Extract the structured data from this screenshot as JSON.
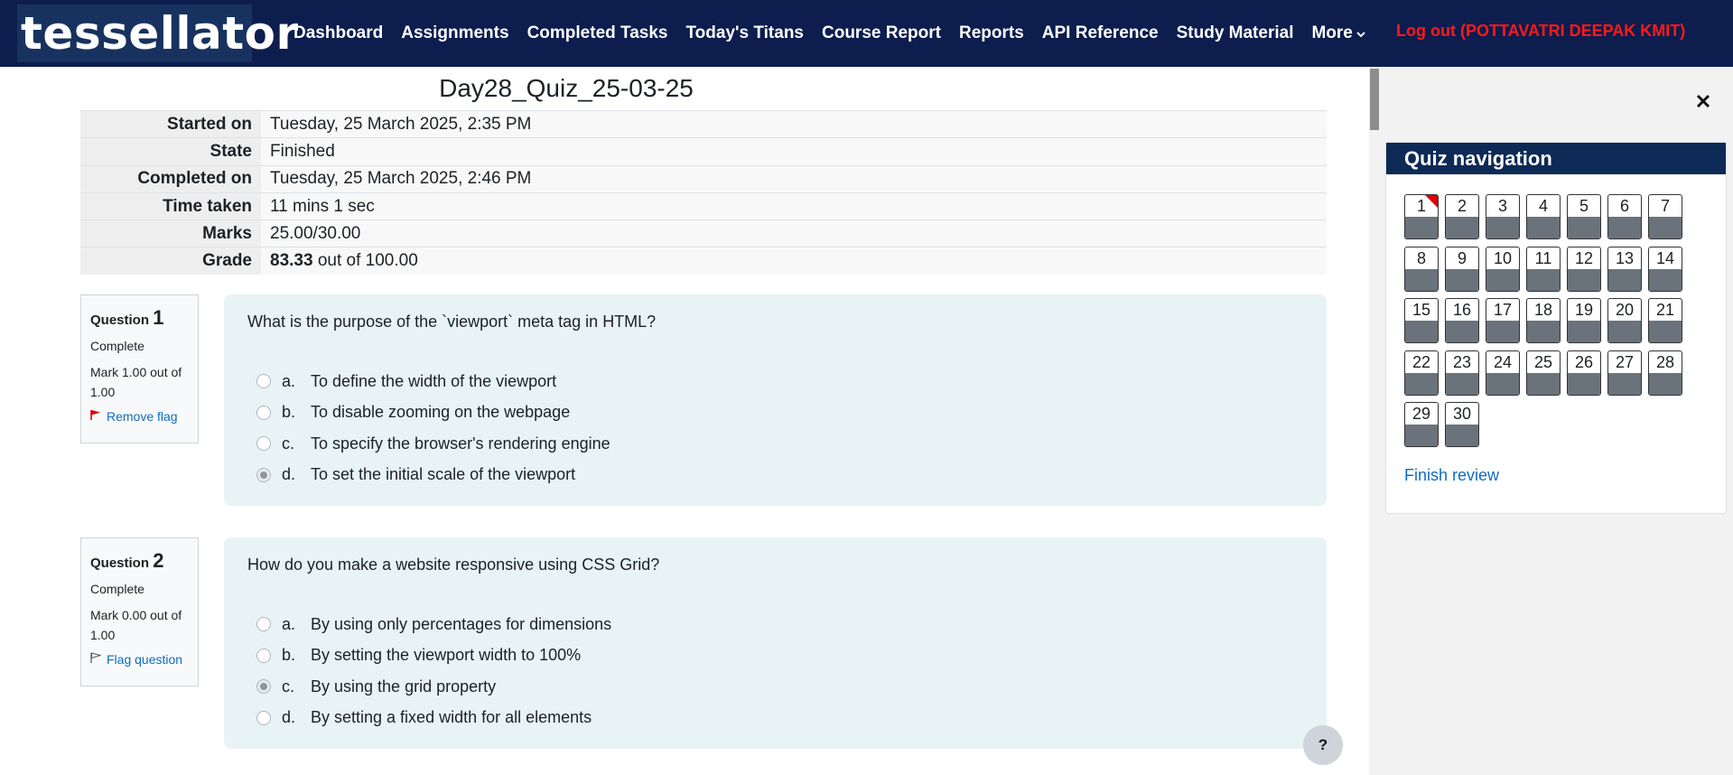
{
  "brand": "tessellator",
  "nav": {
    "items": [
      "Dashboard",
      "Assignments",
      "Completed Tasks",
      "Today's Titans",
      "Course Report",
      "Reports",
      "API Reference",
      "Study Material"
    ],
    "more": "More",
    "logout": "Log out (POTTAVATRI DEEPAK KMIT)"
  },
  "quiz": {
    "title": "Day28_Quiz_25-03-25",
    "summary": {
      "started_label": "Started on",
      "started": "Tuesday, 25 March 2025, 2:35 PM",
      "state_label": "State",
      "state": "Finished",
      "completed_label": "Completed on",
      "completed": "Tuesday, 25 March 2025, 2:46 PM",
      "time_label": "Time taken",
      "time": "11 mins 1 sec",
      "marks_label": "Marks",
      "marks": "25.00/30.00",
      "grade_label": "Grade",
      "grade_value": "83.33",
      "grade_rest": " out of 100.00"
    }
  },
  "questions": [
    {
      "label": "Question",
      "number": "1",
      "state": "Complete",
      "mark": "Mark 1.00 out of 1.00",
      "flag": "Remove flag",
      "text": "What is the purpose of the `viewport` meta tag in HTML?",
      "answers": [
        {
          "letter": "a.",
          "text": "To define the width of the viewport"
        },
        {
          "letter": "b.",
          "text": "To disable zooming on the webpage"
        },
        {
          "letter": "c.",
          "text": "To specify the browser's rendering engine"
        },
        {
          "letter": "d.",
          "text": "To set the initial scale of the viewport"
        }
      ],
      "selected": "d"
    },
    {
      "label": "Question",
      "number": "2",
      "state": "Complete",
      "mark": "Mark 0.00 out of 1.00",
      "flag": "Flag question",
      "text": "How do you make a website responsive using CSS Grid?",
      "answers": [
        {
          "letter": "a.",
          "text": "By using only percentages for dimensions"
        },
        {
          "letter": "b.",
          "text": "By setting the viewport width to 100%"
        },
        {
          "letter": "c.",
          "text": "By using the grid property"
        },
        {
          "letter": "d.",
          "text": "By setting a fixed width for all elements"
        }
      ],
      "selected": "c"
    }
  ],
  "quiz_nav": {
    "title": "Quiz navigation",
    "buttons": [
      "1",
      "2",
      "3",
      "4",
      "5",
      "6",
      "7",
      "8",
      "9",
      "10",
      "11",
      "12",
      "13",
      "14",
      "15",
      "16",
      "17",
      "18",
      "19",
      "20",
      "21",
      "22",
      "23",
      "24",
      "25",
      "26",
      "27",
      "28",
      "29",
      "30"
    ],
    "flagged": [
      "1"
    ],
    "finish": "Finish review"
  },
  "icons": {
    "close": "close-icon",
    "help": "help-icon",
    "chevron": "chevron-down-icon",
    "flag_filled": "flag-filled-icon",
    "flag_outline": "flag-outline-icon"
  },
  "colors": {
    "navbar": "#0c1d4e",
    "logout": "#ff1a1a",
    "question_bg": "#e7f3f5",
    "nav_header": "#0c2a55",
    "link": "#0f6cbf",
    "flag": "#e00000"
  },
  "help": "?"
}
